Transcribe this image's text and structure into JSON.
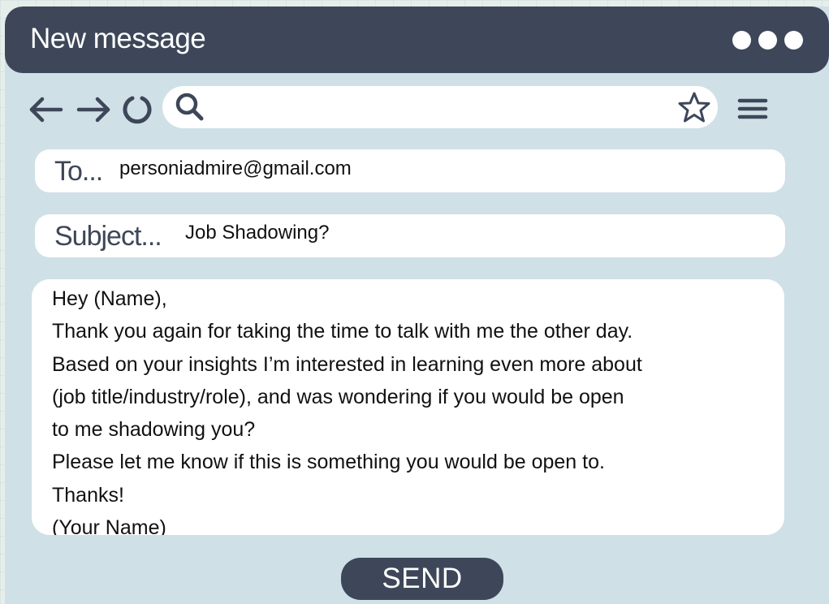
{
  "window": {
    "title": "New message"
  },
  "toolbar": {
    "back_icon": "arrow-left-icon",
    "forward_icon": "arrow-right-icon",
    "reload_icon": "reload-icon",
    "search_icon": "search-icon",
    "search_value": "",
    "bookmark_icon": "star-icon",
    "menu_icon": "hamburger-menu-icon"
  },
  "compose": {
    "to_label": "To...",
    "to_value": "personiadmire@gmail.com",
    "subject_label": "Subject...",
    "subject_value": "Job Shadowing?",
    "body_lines": [
      "Hey (Name),",
      "Thank you again for taking the time to talk with me the other day.",
      "Based on your insights I’m interested in learning even more about",
      "(job title/industry/role), and was wondering if you would be open",
      "to me shadowing you?",
      "Please let me know if this is something you would be open to.",
      "Thanks!",
      "(Your Name)"
    ],
    "send_label": "SEND"
  },
  "colors": {
    "titlebar": "#3e4759",
    "window_bg": "#cfe0e6",
    "field_bg": "#ffffff"
  }
}
